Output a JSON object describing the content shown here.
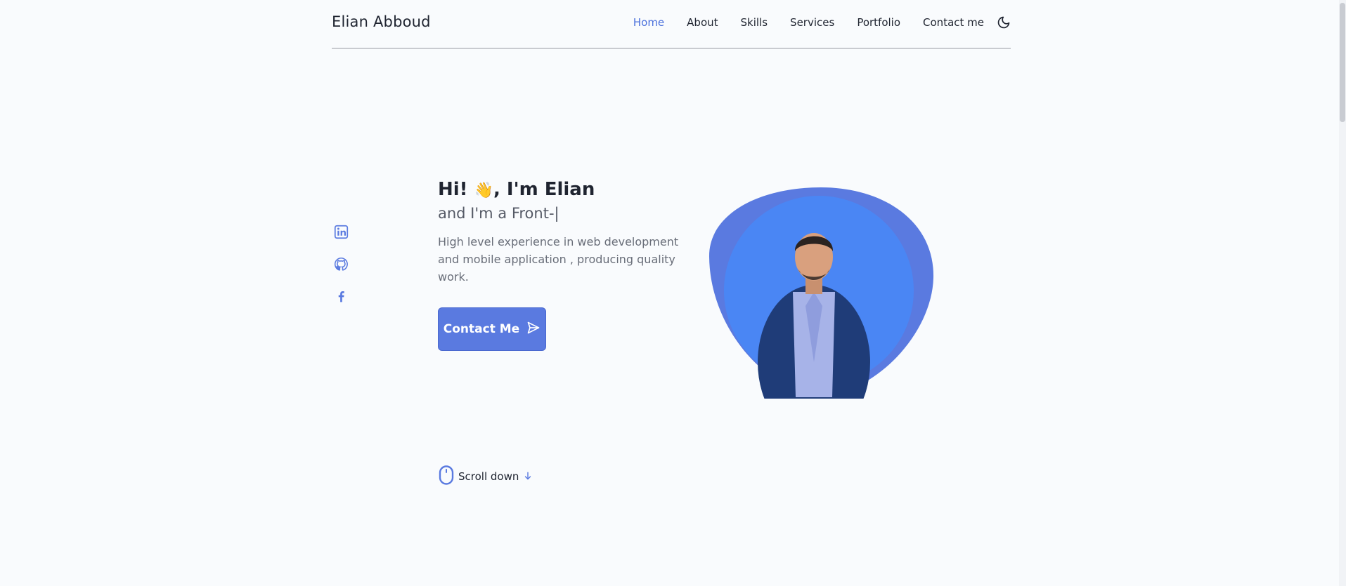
{
  "header": {
    "logo": "Elian Abboud",
    "nav": [
      {
        "label": "Home",
        "active": true
      },
      {
        "label": "About",
        "active": false
      },
      {
        "label": "Skills",
        "active": false
      },
      {
        "label": "Services",
        "active": false
      },
      {
        "label": "Portfolio",
        "active": false
      },
      {
        "label": "Contact me",
        "active": false
      }
    ],
    "theme_icon": "moon-icon"
  },
  "socials": [
    "linkedin-icon",
    "github-icon",
    "facebook-icon"
  ],
  "hero": {
    "greeting_prefix": "Hi!",
    "greeting_emoji": "👋",
    "greeting_suffix": ", I'm Elian",
    "subtitle": "and I'm a Front-|",
    "description": "High level experience in web development and mobile application , producing quality work.",
    "button_label": "Contact Me",
    "button_icon": "send-icon"
  },
  "scroll": {
    "label": "Scroll down",
    "mouse_icon": "mouse-icon",
    "arrow_icon": "arrow-down-icon"
  },
  "colors": {
    "accent": "#4a70dc",
    "button": "#5a7ae0",
    "blob_outer": "#5a7ae0",
    "blob_inner": "#4a86f4",
    "background": "#f9fbfd"
  }
}
